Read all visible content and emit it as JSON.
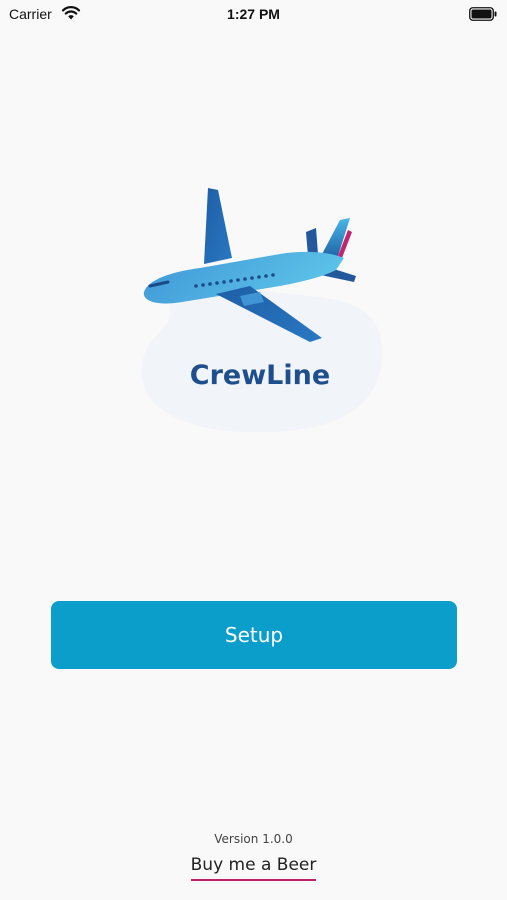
{
  "status_bar": {
    "carrier": "Carrier",
    "time": "1:27 PM",
    "wifi_icon": "wifi-icon",
    "battery_icon": "battery-icon"
  },
  "logo": {
    "brand_text": "CrewLine",
    "icon": "airplane-icon"
  },
  "main": {
    "setup_label": "Setup"
  },
  "footer": {
    "version_text": "Version 1.0.0",
    "beer_link_label": "Buy me a Beer"
  },
  "colors": {
    "accent": "#0c9ecb",
    "link_underline": "#c01f6a",
    "brand_dark": "#1e4f8c",
    "background": "#f9f9f9"
  }
}
